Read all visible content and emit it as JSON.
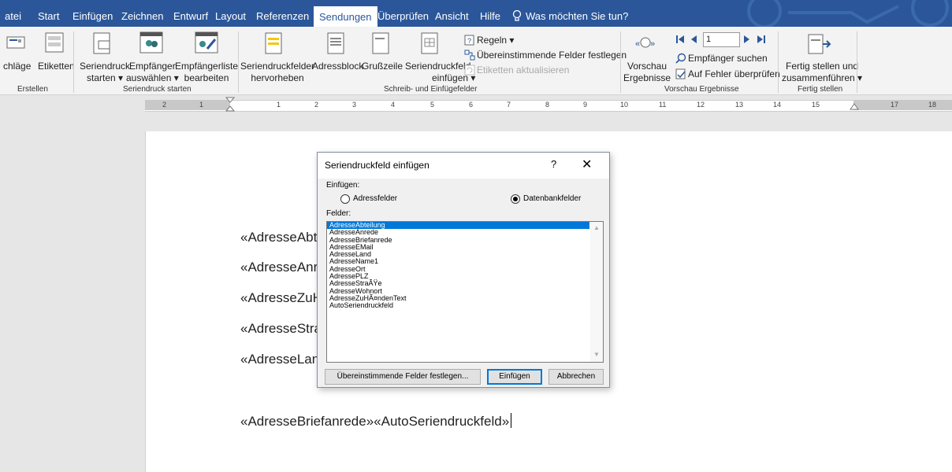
{
  "tabs": {
    "file": "atei",
    "start": "Start",
    "insert": "Einfügen",
    "draw": "Zeichnen",
    "design": "Entwurf",
    "layout": "Layout",
    "references": "Referenzen",
    "mailings": "Sendungen",
    "review": "Überprüfen",
    "view": "Ansicht",
    "help": "Hilfe",
    "tell_me": "Was möchten Sie tun?"
  },
  "ribbon": {
    "create": {
      "envelopes": "chläge",
      "labels": "Etiketten",
      "group": "Erstellen"
    },
    "start_merge": {
      "start_l1": "Seriendruck",
      "start_l2": "starten ▾",
      "select_l1": "Empfänger",
      "select_l2": "auswählen ▾",
      "edit_l1": "Empfängerliste",
      "edit_l2": "bearbeiten",
      "group": "Seriendruck starten"
    },
    "write_insert": {
      "highlight_l1": "Seriendruckfelder",
      "highlight_l2": "hervorheben",
      "address_block": "Adressblock",
      "greeting": "Grußzeile",
      "insert_field_l1": "Seriendruckfeld",
      "insert_field_l2": "einfügen ▾",
      "rules": "Regeln ▾",
      "match_fields": "Übereinstimmende Felder festlegen",
      "update_labels": "Etiketten aktualisieren",
      "group": "Schreib- und Einfügefelder"
    },
    "preview": {
      "preview_l1": "Vorschau",
      "preview_l2": "Ergebnisse",
      "record": "1",
      "find_recipient": "Empfänger suchen",
      "check_errors": "Auf Fehler überprüfen",
      "group": "Vorschau Ergebnisse"
    },
    "finish": {
      "finish_l1": "Fertig stellen und",
      "finish_l2": "zusammenführen ▾",
      "group": "Fertig stellen"
    }
  },
  "ruler": {
    "left": [
      "2",
      "1"
    ],
    "right": [
      "1",
      "2",
      "3",
      "4",
      "5",
      "6",
      "7",
      "8",
      "9",
      "10",
      "11",
      "12",
      "13",
      "14",
      "15",
      "17",
      "18"
    ]
  },
  "document": {
    "lines": [
      "«AdresseAbte",
      "«AdresseAnre",
      "«AdresseZuH",
      "«AdresseStra",
      "«AdresseLand"
    ],
    "final_line": "«AdresseBriefanrede»«AutoSeriendruckfeld»"
  },
  "dialog": {
    "title": "Seriendruckfeld einfügen",
    "help": "?",
    "close": "✕",
    "insert_label": "Einfügen:",
    "option_address": "Adressfelder",
    "option_database": "Datenbankfelder",
    "fields_label": "Felder:",
    "fields": [
      "AdresseAbteilung",
      "AdresseAnrede",
      "AdresseBriefanrede",
      "AdresseEMail",
      "AdresseLand",
      "AdresseName1",
      "AdresseOrt",
      "AdressePLZ",
      "AdresseStraÃŸe",
      "AdresseWohnort",
      "AdresseZuHÃ¤ndenText",
      "AutoSeriendruckfeld"
    ],
    "selected_field": "AdresseAbteilung",
    "btn_match": "Übereinstimmende Felder festlegen...",
    "btn_insert": "Einfügen",
    "btn_cancel": "Abbrechen"
  }
}
